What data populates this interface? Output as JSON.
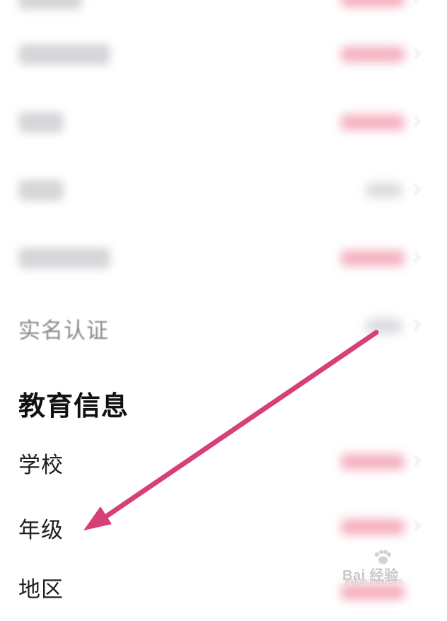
{
  "profile_section": {
    "rows": [
      {
        "label": "",
        "value": ""
      },
      {
        "label": "",
        "value": ""
      },
      {
        "label": "",
        "value": ""
      },
      {
        "label": "",
        "value": ""
      },
      {
        "label": "",
        "value": ""
      },
      {
        "label": "实名认证",
        "value": ""
      }
    ]
  },
  "education_section": {
    "title": "教育信息",
    "rows": [
      {
        "label": "学校",
        "value": ""
      },
      {
        "label": "年级",
        "value": ""
      },
      {
        "label": "地区",
        "value": ""
      }
    ]
  },
  "annotation": {
    "arrow_color": "#d63f78"
  },
  "watermark": {
    "brand": "Bai 经验",
    "url": "jingyan.baidu.com"
  }
}
